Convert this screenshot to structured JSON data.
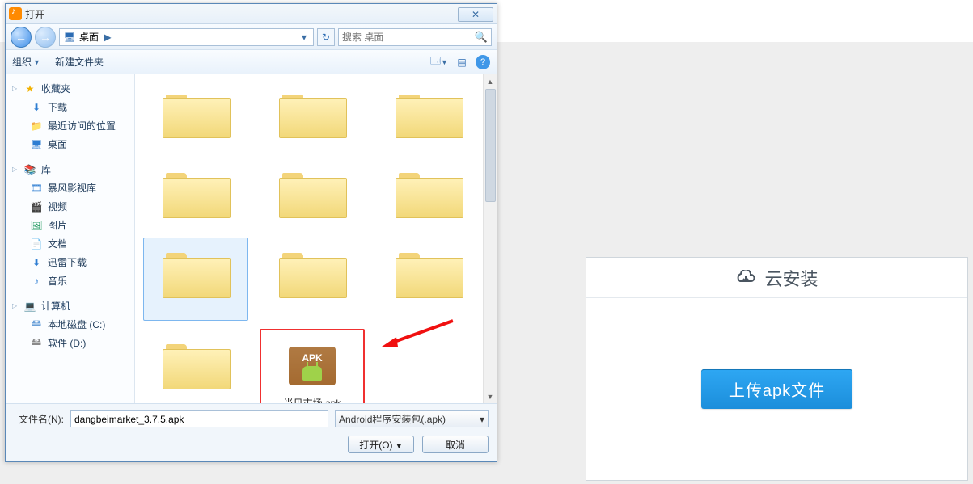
{
  "dialog": {
    "title": "打开",
    "close_glyph": "✕",
    "nav": {
      "back_glyph": "←",
      "forward_glyph": "→",
      "location_icon_glyph": "🖥",
      "location_text": "桌面",
      "location_arrow": "▶",
      "dropdown_glyph": "▾",
      "refresh_glyph": "↻"
    },
    "search": {
      "placeholder": "搜索 桌面",
      "icon_glyph": "🔍"
    },
    "toolbar": {
      "organize": "组织",
      "new_folder": "新建文件夹",
      "view_glyph": "🗔",
      "preview_glyph": "▤",
      "help_glyph": "?"
    },
    "sidebar": {
      "favorites": {
        "label": "收藏夹",
        "star_glyph": "★",
        "items": [
          {
            "icon": "⬇",
            "label": "下载",
            "color": "#2d7dd2"
          },
          {
            "icon": "📁",
            "label": "最近访问的位置",
            "color": "#caa96a"
          },
          {
            "icon": "🖥",
            "label": "桌面",
            "color": "#2d7dd2"
          }
        ]
      },
      "libraries": {
        "label": "库",
        "icon_glyph": "📚",
        "items": [
          {
            "icon": "🎞",
            "label": "暴风影视库",
            "color": "#2d7dd2"
          },
          {
            "icon": "🎬",
            "label": "视频",
            "color": "#2d7dd2"
          },
          {
            "icon": "🖼",
            "label": "图片",
            "color": "#2da06a"
          },
          {
            "icon": "📄",
            "label": "文档",
            "color": "#7a7a7a"
          },
          {
            "icon": "⬇",
            "label": "迅雷下载",
            "color": "#2d7dd2"
          },
          {
            "icon": "♪",
            "label": "音乐",
            "color": "#2d7dd2"
          }
        ]
      },
      "computer": {
        "label": "计算机",
        "icon_glyph": "💻",
        "items": [
          {
            "icon": "🖴",
            "label": "本地磁盘 (C:)",
            "color": "#6aa0d8"
          },
          {
            "icon": "🖴",
            "label": "软件 (D:)",
            "color": "#8a8a8a"
          }
        ]
      }
    },
    "files": {
      "row1": [
        {
          "label": " ",
          "thumb": "empty"
        },
        {
          "label": " ",
          "thumb": "a"
        },
        {
          "label": " ",
          "thumb": "b"
        }
      ],
      "row2": [
        {
          "label": " ",
          "thumb": "a",
          "selected": true
        },
        {
          "label": " ",
          "thumb": "b"
        },
        {
          "label": " ",
          "thumb": "c"
        }
      ],
      "row3": [
        {
          "label": " ",
          "thumb": "empty"
        }
      ],
      "apk": {
        "badge": "APK",
        "label": "当贝市场.apk"
      }
    },
    "footer": {
      "filename_label": "文件名(N):",
      "filename_value": "dangbeimarket_3.7.5.apk",
      "filetype_value": "Android程序安装包(.apk)",
      "open_label": "打开(O)",
      "cancel_label": "取消"
    }
  },
  "cloud": {
    "title": "云安装",
    "upload_label": "上传apk文件"
  }
}
